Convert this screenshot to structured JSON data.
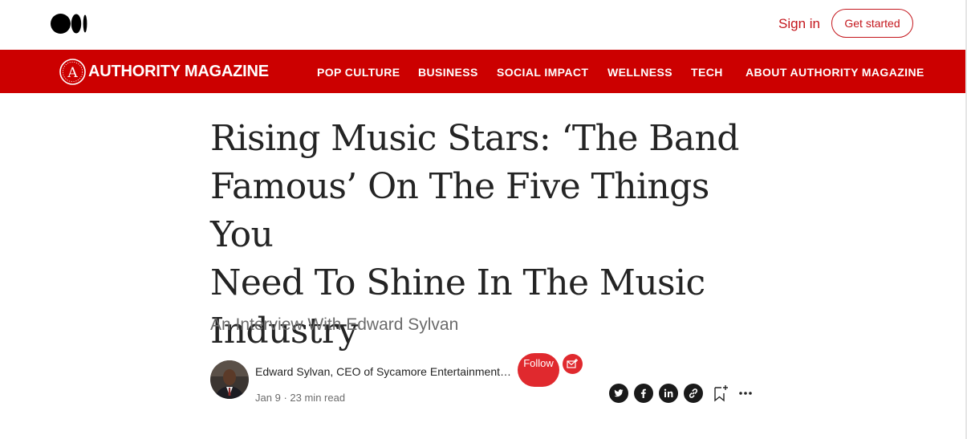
{
  "topbar": {
    "logo_icon": "medium-logo",
    "signin_label": "Sign in",
    "get_started_label": "Get started"
  },
  "publication": {
    "name": "AUTHORITY MAGAZINE",
    "seal_letter": "A",
    "brand_color": "#cc0000",
    "nav": [
      "POP CULTURE",
      "BUSINESS",
      "SOCIAL IMPACT",
      "WELLNESS",
      "TECH",
      "ABOUT AUTHORITY MAGAZINE"
    ]
  },
  "article": {
    "title_lines": [
      "Rising Music Stars: ‘The Band",
      "Famous’ On The Five Things You",
      "Need To Shine In The Music",
      "Industry"
    ],
    "subtitle": "An Interview With Edward Sylvan",
    "author": "Edward Sylvan, CEO of Sycamore Entertainment…",
    "date": "Jan 9",
    "separator": "·",
    "read_time": "23 min read",
    "follow_label": "Follow"
  },
  "actions": {
    "share_icons": [
      "twitter-icon",
      "facebook-icon",
      "linkedin-icon",
      "link-icon"
    ],
    "bookmark_icon": "bookmark-add-icon",
    "more_icon": "more-icon",
    "subscribe_icon": "email-subscribe-icon",
    "accent_color": "#e0292e"
  }
}
